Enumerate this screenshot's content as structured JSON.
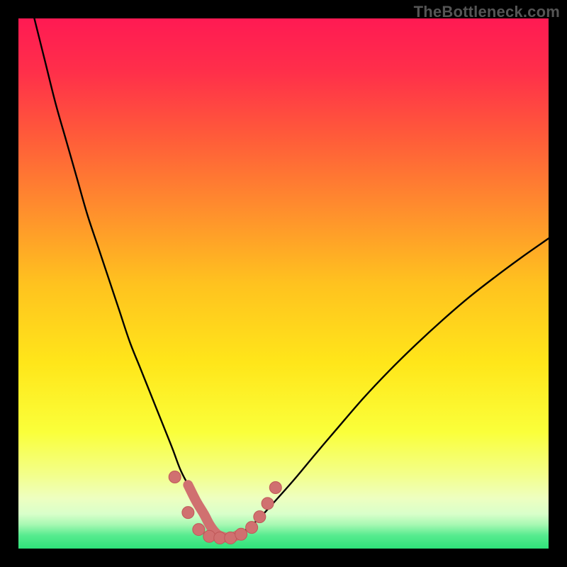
{
  "watermark": "TheBottleneck.com",
  "colors": {
    "black": "#000000",
    "curve": "#000000",
    "dot_fill": "#d07070",
    "dot_stroke": "#c05858",
    "green": "#2fe37a"
  },
  "gradient_stops": [
    {
      "offset": 0.0,
      "color": "#ff1a53"
    },
    {
      "offset": 0.1,
      "color": "#ff2f4a"
    },
    {
      "offset": 0.22,
      "color": "#ff5a3a"
    },
    {
      "offset": 0.35,
      "color": "#ff8a2e"
    },
    {
      "offset": 0.5,
      "color": "#ffc21f"
    },
    {
      "offset": 0.65,
      "color": "#ffe61a"
    },
    {
      "offset": 0.78,
      "color": "#faff3a"
    },
    {
      "offset": 0.86,
      "color": "#f3ff8a"
    },
    {
      "offset": 0.905,
      "color": "#eeffc0"
    },
    {
      "offset": 0.935,
      "color": "#d8ffca"
    },
    {
      "offset": 0.955,
      "color": "#a6f8b2"
    },
    {
      "offset": 0.975,
      "color": "#57eb8f"
    },
    {
      "offset": 1.0,
      "color": "#2fe37a"
    }
  ],
  "chart_data": {
    "type": "line",
    "title": "",
    "xlabel": "",
    "ylabel": "",
    "xlim": [
      0,
      100
    ],
    "ylim": [
      0,
      100
    ],
    "grid": false,
    "series": [
      {
        "name": "bottleneck-curve",
        "x": [
          3,
          5,
          7,
          9,
          11,
          13,
          15,
          17,
          19,
          21,
          23,
          25,
          27,
          29,
          30.5,
          32,
          33.5,
          35,
          36,
          37,
          38,
          40,
          42,
          45,
          48,
          52,
          56,
          60,
          65,
          70,
          75,
          80,
          85,
          90,
          95,
          100
        ],
        "values": [
          100,
          92,
          84,
          77,
          70,
          63,
          57,
          51,
          45,
          39,
          34,
          29,
          24,
          19,
          15,
          12,
          9,
          6.5,
          4.6,
          3.2,
          2.4,
          2.0,
          2.9,
          5.3,
          8.5,
          13.0,
          17.8,
          22.5,
          28.3,
          33.6,
          38.5,
          43.1,
          47.4,
          51.3,
          55.0,
          58.5
        ]
      }
    ],
    "annotations": {
      "dots": [
        {
          "x": 29.5,
          "y": 13.5
        },
        {
          "x": 32.0,
          "y": 6.8
        },
        {
          "x": 34.0,
          "y": 3.6
        },
        {
          "x": 36.0,
          "y": 2.3
        },
        {
          "x": 38.0,
          "y": 2.0
        },
        {
          "x": 40.0,
          "y": 2.0
        },
        {
          "x": 42.0,
          "y": 2.7
        },
        {
          "x": 44.0,
          "y": 4.0
        },
        {
          "x": 45.5,
          "y": 6.0
        },
        {
          "x": 47.0,
          "y": 8.5
        },
        {
          "x": 48.5,
          "y": 11.5
        }
      ],
      "thick_segment": {
        "x_start": 32,
        "x_end": 44
      }
    }
  }
}
